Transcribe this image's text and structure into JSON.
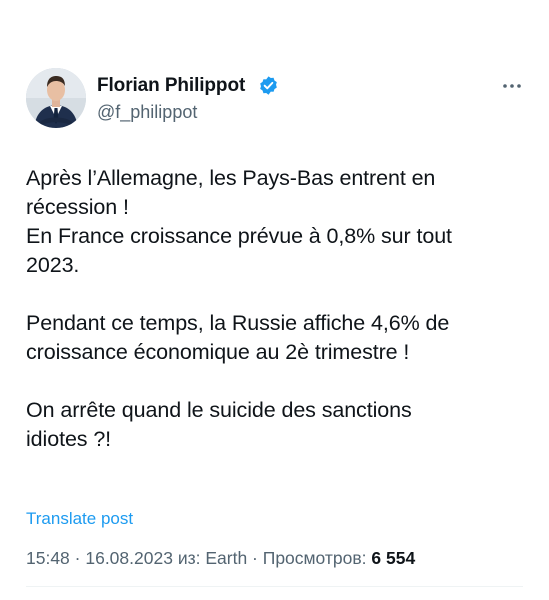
{
  "author": {
    "display_name": "Florian Philippot",
    "handle": "@f_philippot",
    "verified": true,
    "avatar_icon": "profile-photo"
  },
  "tweet": {
    "paragraphs": [
      [
        "Après l’Allemagne, les Pays-Bas entrent en",
        "récession !",
        "En France croissance prévue à 0,8% sur tout",
        "2023."
      ],
      [
        "Pendant ce temps, la Russie affiche 4,6% de",
        "croissance économique au 2è trimestre !"
      ],
      [
        "On arrête quand le suicide des sanctions",
        "idiotes ?!"
      ]
    ],
    "translate_label": "Translate post"
  },
  "meta": {
    "time": "15:48",
    "separator": " · ",
    "date": "16.08.2023",
    "source_prefix": " из: ",
    "source": "Earth",
    "views_label": "Просмотров: ",
    "views_count": "6 554"
  },
  "colors": {
    "accent": "#1d9bf0",
    "text": "#0f1419",
    "secondary": "#536471",
    "verified_badge": "#1d9bf0"
  },
  "icons": {
    "verified": "verified-badge-icon",
    "more": "more-options-icon"
  }
}
